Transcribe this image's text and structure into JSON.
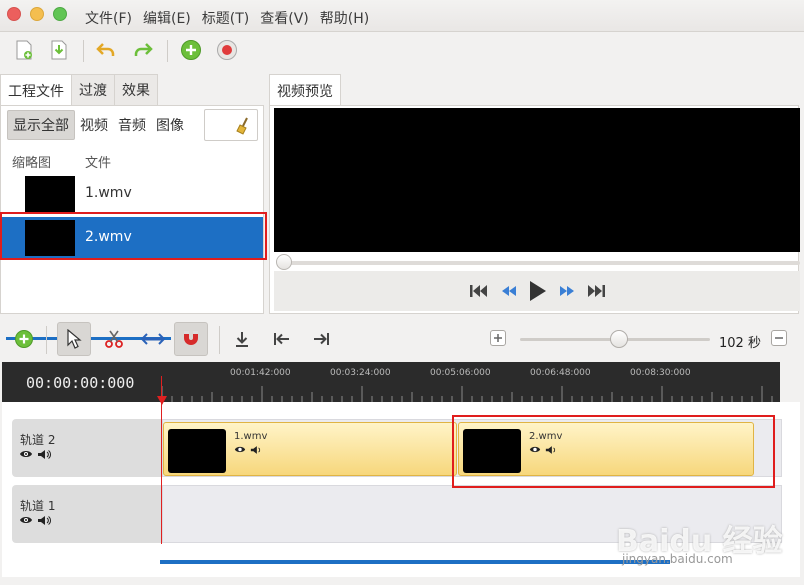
{
  "menu": [
    "文件(F)",
    "编辑(E)",
    "标题(T)",
    "查看(V)",
    "帮助(H)"
  ],
  "left_panel": {
    "tabs": [
      "工程文件",
      "过渡",
      "效果"
    ],
    "filters": [
      "显示全部",
      "视频",
      "音频",
      "图像"
    ],
    "columns": {
      "thumbnail": "缩略图",
      "file": "文件"
    },
    "files": [
      {
        "name": "1.wmv",
        "selected": false
      },
      {
        "name": "2.wmv",
        "selected": true
      }
    ]
  },
  "preview": {
    "tab": "视频预览"
  },
  "timeline": {
    "timecode": "00:00:00:000",
    "ruler_ticks": [
      "00:01:42:000",
      "00:03:24:000",
      "00:05:06:000",
      "00:06:48:000",
      "00:08:30:000"
    ],
    "zoom_label": "102 秒",
    "tracks": [
      {
        "name": "轨道 2",
        "clips": [
          "1.wmv",
          "2.wmv"
        ]
      },
      {
        "name": "轨道 1",
        "clips": []
      }
    ]
  },
  "watermark": {
    "logo": "Baidu 经验",
    "url": "jingyan.baidu.com"
  },
  "colors": {
    "selection": "#1d6fc4",
    "highlight_box": "#e01d1d",
    "clip": "#f7d77c"
  }
}
